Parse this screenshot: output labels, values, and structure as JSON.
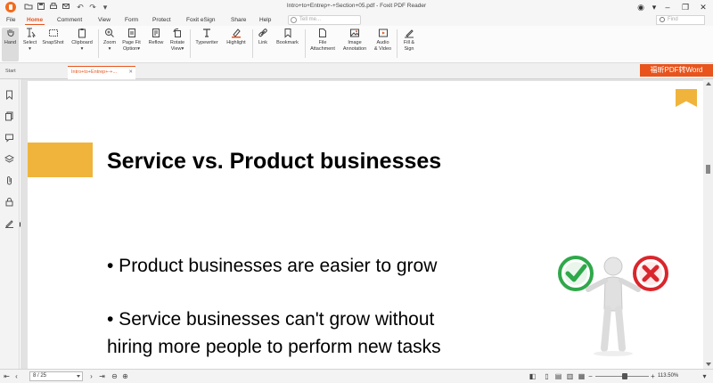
{
  "window": {
    "title": "Intro+to+Entrep+-+Section+05.pdf - Foxit PDF Reader"
  },
  "ribbon_tabs": [
    "File",
    "Home",
    "Comment",
    "View",
    "Form",
    "Protect",
    "Foxit eSign",
    "Share",
    "Help"
  ],
  "active_tab": "Home",
  "search": {
    "tell_me_placeholder": "Tell me...",
    "find_placeholder": "Find"
  },
  "ribbon": {
    "hand": "Hand",
    "select": "Select",
    "snapshot": "SnapShot",
    "clipboard": "Clipboard",
    "zoom": "Zoom",
    "page_fit": "Page Fit",
    "page_fit_2": "Option",
    "reflow": "Reflow",
    "rotate": "Rotate",
    "rotate_2": "View",
    "typewriter": "Typewriter",
    "highlight": "Highlight",
    "link": "Link",
    "bookmark": "Bookmark",
    "file_attachment": "File",
    "file_attachment_2": "Attachment",
    "image_annotation": "Image",
    "image_annotation_2": "Annotation",
    "audio_video": "Audio",
    "audio_video_2": "& Video",
    "fill_sign": "Fill &",
    "fill_sign_2": "Sign"
  },
  "doc_tabs": {
    "start": "Start",
    "current": "Intro+to+Entrep+-+..."
  },
  "convert_button": "福昕PDF转Word",
  "slide": {
    "title": "Service vs. Product businesses",
    "bullet1": "•   Product businesses are easier to grow",
    "bullet2_line1": "•   Service businesses can't grow without",
    "bullet2_line2": "hiring more people to perform new tasks"
  },
  "statusbar": {
    "page_indicator": "8 / 25",
    "zoom_level": "113.50%"
  },
  "colors": {
    "accent_orange": "#e8541c",
    "slide_gold": "#f0b43c",
    "check_green": "#2fa84a",
    "cross_red": "#d9262c"
  }
}
